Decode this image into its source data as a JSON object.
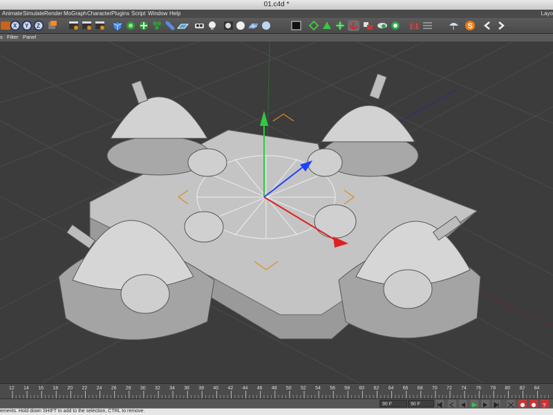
{
  "window": {
    "title": "01.c4d *"
  },
  "menu": {
    "items": [
      "Animate",
      "Simulate",
      "Render",
      "MoGraph",
      "Character",
      "Plugins",
      "Script",
      "Window",
      "Help"
    ],
    "layout_label": "Layo"
  },
  "toolbar": {
    "icons": [
      "undo-icon",
      "axis-x-icon",
      "axis-y-icon",
      "axis-z-icon",
      "coord-system-icon",
      "render-view-icon",
      "render-picture-viewer-icon",
      "render-settings-icon",
      "cube-primitive-icon",
      "bend-deformer-icon",
      "nurbs-icon",
      "array-icon",
      "capsule-icon",
      "floor-icon",
      "camera-icon",
      "light-icon",
      "sky-icon",
      "environment-icon",
      "display-mode-icon",
      "snap-icon",
      "workplane-icon",
      "axis-tool-icon",
      "texture-icon",
      "uv-icon",
      "edge-icon",
      "sphere-icon",
      "grid-icon",
      "motion-record-icon",
      "cloth-icon",
      "script-s-icon",
      "prev-arrow-icon",
      "next-arrow-icon"
    ],
    "accent": "#ff8a1c"
  },
  "view_menu": {
    "items": [
      "s",
      "Filter",
      "Panel"
    ]
  },
  "timeline": {
    "ticks": [
      "12",
      "14",
      "16",
      "18",
      "20",
      "22",
      "24",
      "26",
      "28",
      "30",
      "32",
      "34",
      "36",
      "38",
      "40",
      "42",
      "44",
      "46",
      "48",
      "50",
      "52",
      "54",
      "56",
      "58",
      "60",
      "62",
      "64",
      "66",
      "68",
      "70",
      "72",
      "74",
      "76",
      "78",
      "80",
      "82",
      "84"
    ]
  },
  "controls": {
    "end_frame": "90 F",
    "max_frame": "90 F"
  },
  "status": {
    "text": "ements. Hold down SHIFT to add to the selection, CTRL to remove."
  },
  "colors": {
    "viewport_bg": "#3c3c3c",
    "grid": "#4a4a4a",
    "axis_y": "#2ecc40",
    "axis_x": "#e02020",
    "axis_z": "#2040ff",
    "model": "#c8c8c8"
  }
}
